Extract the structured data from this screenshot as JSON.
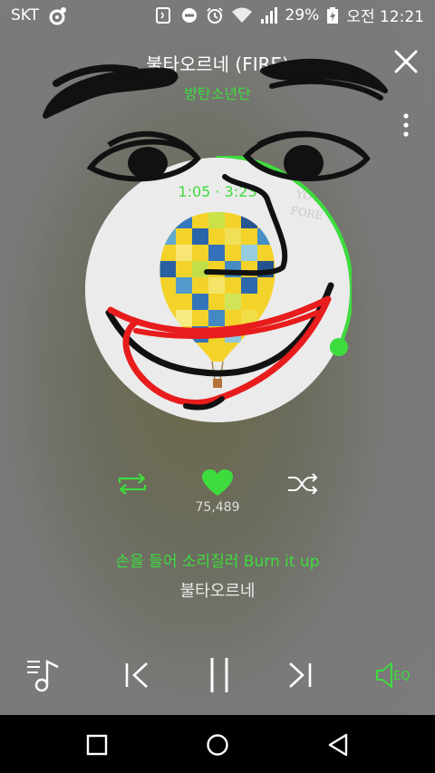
{
  "status_bar": {
    "carrier": "SKT",
    "battery": "29%",
    "time": "오전 12:21"
  },
  "song": {
    "title": "불타오르네 (FIRE)",
    "artist": "방탄소년단"
  },
  "playback": {
    "elapsed": "1:05",
    "separator": "·",
    "total": "3:23",
    "progress": 0.32
  },
  "actions": {
    "likes": "75,489"
  },
  "lyrics": {
    "current": "손을 들어 소리질러 Burn it up",
    "next": "불타오르네"
  },
  "player": {
    "eq_label": "EQ"
  },
  "colors": {
    "accent": "#3ddc3d",
    "navbar": "#000000"
  },
  "icons": [
    "close-icon",
    "more-icon",
    "repeat-icon",
    "heart-icon",
    "shuffle-icon",
    "playlist-icon",
    "previous-icon",
    "pause-icon",
    "next-icon",
    "eq-icon",
    "back-icon",
    "home-icon",
    "recents-icon"
  ]
}
